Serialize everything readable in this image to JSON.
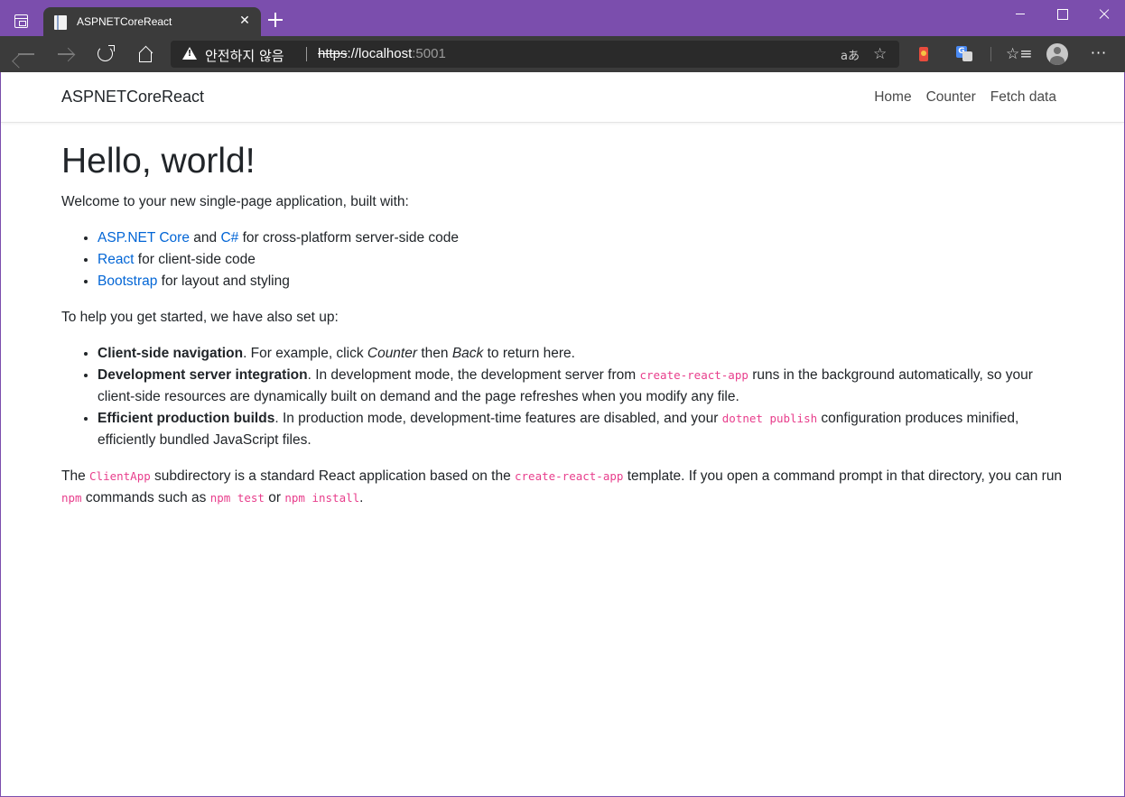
{
  "browser": {
    "tab": {
      "title": "ASPNETCoreReact"
    },
    "address": {
      "security_warning": "안전하지 않음",
      "url_scheme": "https",
      "url_sep": "://",
      "url_host": "localhost",
      "url_port": ":5001"
    },
    "read_aloud": "aあ",
    "add_favorite": "☆",
    "favorites": "☆≡",
    "more": "···",
    "tab_close": "✕"
  },
  "app": {
    "brand": "ASPNETCoreReact",
    "nav": [
      "Home",
      "Counter",
      "Fetch data"
    ]
  },
  "content": {
    "heading": "Hello, world!",
    "intro": "Welcome to your new single-page application, built with:",
    "built_with": [
      {
        "link1": "ASP.NET Core",
        "mid": " and ",
        "link2": "C#",
        "rest": " for cross-platform server-side code"
      },
      {
        "link1": "React",
        "rest": " for client-side code"
      },
      {
        "link1": "Bootstrap",
        "rest": " for layout and styling"
      }
    ],
    "setup_intro": "To help you get started, we have also set up:",
    "features": [
      {
        "title": "Client-side navigation",
        "t1": ". For example, click ",
        "em1": "Counter",
        "t2": " then ",
        "em2": "Back",
        "t3": " to return here."
      },
      {
        "title": "Development server integration",
        "t1": ". In development mode, the development server from ",
        "code1": "create-react-app",
        "t2": " runs in the background automatically, so your client-side resources are dynamically built on demand and the page refreshes when you modify any file."
      },
      {
        "title": "Efficient production builds",
        "t1": ". In production mode, development-time features are disabled, and your ",
        "code1": "dotnet publish",
        "t2": " configuration produces minified, efficiently bundled JavaScript files."
      }
    ],
    "footer": {
      "t1": "The ",
      "code1": "ClientApp",
      "t2": " subdirectory is a standard React application based on the ",
      "code2": "create-react-app",
      "t3": " template. If you open a command prompt in that directory, you can run ",
      "code3": "npm",
      "t4": " commands such as ",
      "code4": "npm test",
      "t5": " or ",
      "code5": "npm install",
      "t6": "."
    }
  },
  "colors": {
    "titlebar": "#7b4ead",
    "toolbar": "#3b3b3b",
    "link": "#0366d6",
    "code": "#e83e8c"
  }
}
